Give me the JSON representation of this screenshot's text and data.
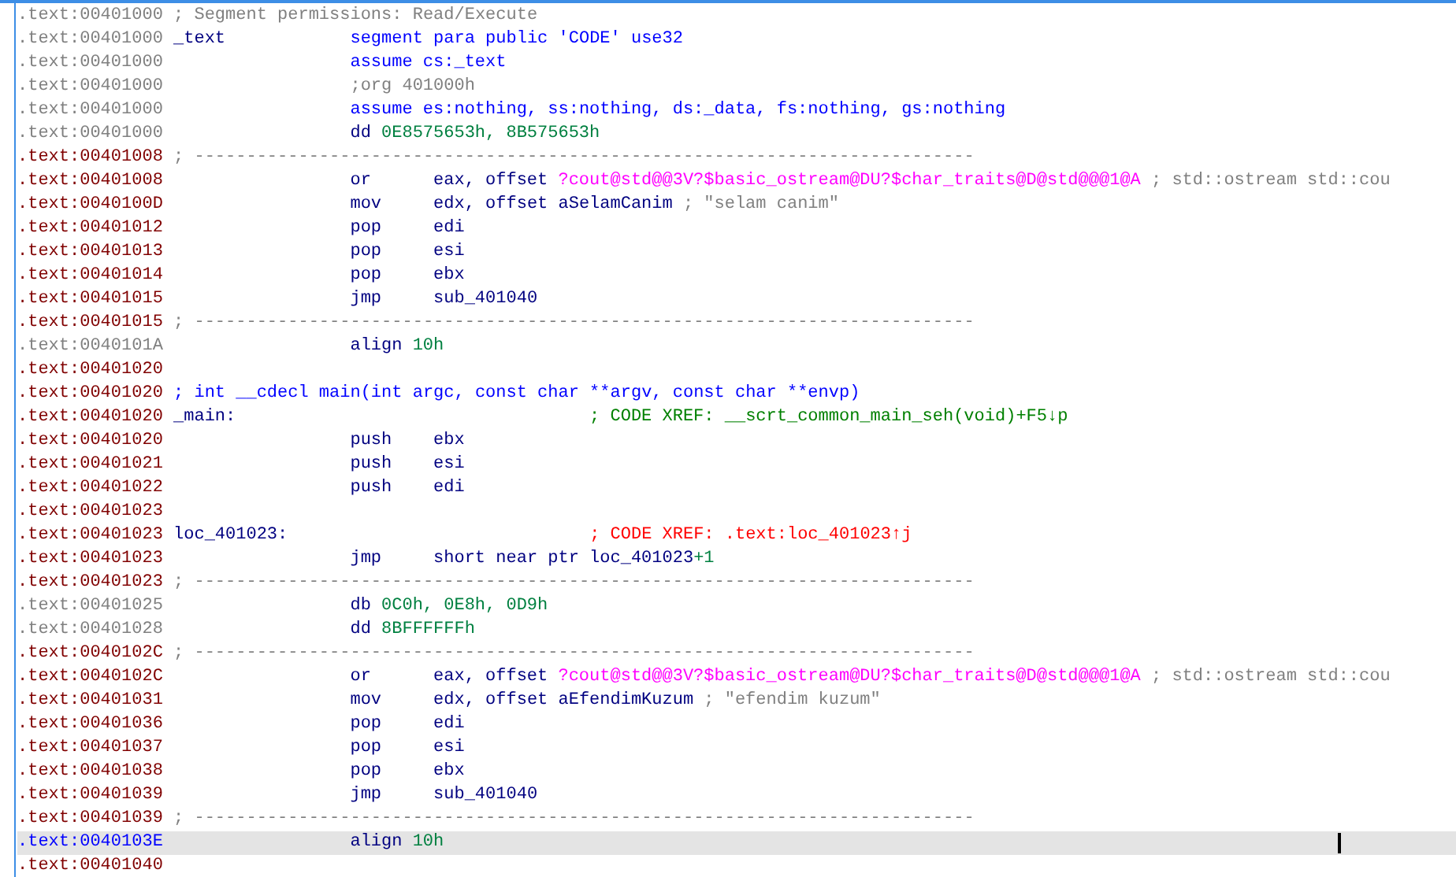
{
  "listing": [
    {
      "address": {
        "text": ".text:00401000",
        "kind": "data"
      },
      "selected": false,
      "comment": {
        "text": "; Segment permissions: Read/Execute",
        "color": "#808080",
        "kind": "header"
      }
    },
    {
      "address": {
        "text": ".text:00401000",
        "kind": "data"
      },
      "selected": false,
      "label": "_text",
      "mnemonic": {
        "text": "segment",
        "kind": "directive"
      },
      "operands": [
        {
          "text": "para public 'CODE' use32",
          "kind": "blue"
        }
      ]
    },
    {
      "address": {
        "text": ".text:00401000",
        "kind": "data"
      },
      "selected": false,
      "mnemonic": {
        "text": "assume",
        "kind": "directive"
      },
      "operands": [
        {
          "text": "cs:_text",
          "kind": "blue"
        }
      ]
    },
    {
      "address": {
        "text": ".text:00401000",
        "kind": "data"
      },
      "selected": false,
      "comment": {
        "text": ";org 401000h",
        "color": "#808080",
        "kind": "code"
      }
    },
    {
      "address": {
        "text": ".text:00401000",
        "kind": "data"
      },
      "selected": false,
      "mnemonic": {
        "text": "assume",
        "kind": "directive"
      },
      "operands": [
        {
          "text": "es:nothing, ss:nothing, ds:_data, fs:nothing, gs:nothing",
          "kind": "blue"
        }
      ]
    },
    {
      "address": {
        "text": ".text:00401000",
        "kind": "data"
      },
      "selected": false,
      "mnemonic": {
        "text": "dd",
        "kind": "data"
      },
      "operands": [
        {
          "text": "0E8575653h, 8B575653h",
          "kind": "number"
        }
      ]
    },
    {
      "address": {
        "text": ".text:00401008",
        "kind": "code"
      },
      "selected": false,
      "comment": {
        "text": "; ---------------------------------------------------------------------------",
        "color": "#808080",
        "kind": "header"
      }
    },
    {
      "address": {
        "text": ".text:00401008",
        "kind": "code"
      },
      "selected": false,
      "mnemonic": {
        "text": "or",
        "kind": "instruction"
      },
      "operands": [
        {
          "text": "eax, offset ",
          "kind": "navy"
        },
        {
          "text": "?cout@std@@3V?$basic_ostream@DU?$char_traits@D@std@@@1@A",
          "kind": "import"
        }
      ],
      "comment": {
        "text": "; std::ostream std::cou",
        "color": "#808080",
        "kind": "inline"
      }
    },
    {
      "address": {
        "text": ".text:0040100D",
        "kind": "code"
      },
      "selected": false,
      "mnemonic": {
        "text": "mov",
        "kind": "instruction"
      },
      "operands": [
        {
          "text": "edx, offset aSelamCanim",
          "kind": "navy"
        }
      ],
      "comment": {
        "text": "; \"selam canim\"",
        "color": "#808080",
        "kind": "inline"
      }
    },
    {
      "address": {
        "text": ".text:00401012",
        "kind": "code"
      },
      "selected": false,
      "mnemonic": {
        "text": "pop",
        "kind": "instruction"
      },
      "operands": [
        {
          "text": "edi",
          "kind": "navy"
        }
      ]
    },
    {
      "address": {
        "text": ".text:00401013",
        "kind": "code"
      },
      "selected": false,
      "mnemonic": {
        "text": "pop",
        "kind": "instruction"
      },
      "operands": [
        {
          "text": "esi",
          "kind": "navy"
        }
      ]
    },
    {
      "address": {
        "text": ".text:00401014",
        "kind": "code"
      },
      "selected": false,
      "mnemonic": {
        "text": "pop",
        "kind": "instruction"
      },
      "operands": [
        {
          "text": "ebx",
          "kind": "navy"
        }
      ]
    },
    {
      "address": {
        "text": ".text:00401015",
        "kind": "code"
      },
      "selected": false,
      "mnemonic": {
        "text": "jmp",
        "kind": "instruction"
      },
      "operands": [
        {
          "text": "sub_401040",
          "kind": "navy"
        }
      ]
    },
    {
      "address": {
        "text": ".text:00401015",
        "kind": "code"
      },
      "selected": false,
      "comment": {
        "text": "; ---------------------------------------------------------------------------",
        "color": "#808080",
        "kind": "header"
      }
    },
    {
      "address": {
        "text": ".text:0040101A",
        "kind": "data"
      },
      "selected": false,
      "mnemonic": {
        "text": "align",
        "kind": "data"
      },
      "operands": [
        {
          "text": "10h",
          "kind": "number"
        }
      ]
    },
    {
      "address": {
        "text": ".text:00401020",
        "kind": "code"
      },
      "selected": false
    },
    {
      "address": {
        "text": ".text:00401020",
        "kind": "code"
      },
      "selected": false,
      "comment": {
        "text": "; int __cdecl main(int argc, const char **argv, const char **envp)",
        "color": "#0000ff",
        "kind": "header"
      }
    },
    {
      "address": {
        "text": ".text:00401020",
        "kind": "code"
      },
      "selected": false,
      "label": "_main:",
      "comment": {
        "text": "; CODE XREF: __scrt_common_main_seh(void)+F5↓p",
        "color": "#008000",
        "kind": "xref"
      }
    },
    {
      "address": {
        "text": ".text:00401020",
        "kind": "code"
      },
      "selected": false,
      "mnemonic": {
        "text": "push",
        "kind": "instruction"
      },
      "operands": [
        {
          "text": "ebx",
          "kind": "navy"
        }
      ]
    },
    {
      "address": {
        "text": ".text:00401021",
        "kind": "code"
      },
      "selected": false,
      "mnemonic": {
        "text": "push",
        "kind": "instruction"
      },
      "operands": [
        {
          "text": "esi",
          "kind": "navy"
        }
      ]
    },
    {
      "address": {
        "text": ".text:00401022",
        "kind": "code"
      },
      "selected": false,
      "mnemonic": {
        "text": "push",
        "kind": "instruction"
      },
      "operands": [
        {
          "text": "edi",
          "kind": "navy"
        }
      ]
    },
    {
      "address": {
        "text": ".text:00401023",
        "kind": "code"
      },
      "selected": false
    },
    {
      "address": {
        "text": ".text:00401023",
        "kind": "code"
      },
      "selected": false,
      "label": "loc_401023:",
      "comment": {
        "text": "; CODE XREF: .text:loc_401023↑j",
        "color": "#ff0000",
        "kind": "xref"
      }
    },
    {
      "address": {
        "text": ".text:00401023",
        "kind": "code"
      },
      "selected": false,
      "mnemonic": {
        "text": "jmp",
        "kind": "instruction"
      },
      "operands": [
        {
          "text": "short near ptr loc_401023",
          "kind": "navy"
        },
        {
          "text": "+1",
          "kind": "number"
        }
      ]
    },
    {
      "address": {
        "text": ".text:00401023",
        "kind": "code"
      },
      "selected": false,
      "comment": {
        "text": "; ---------------------------------------------------------------------------",
        "color": "#808080",
        "kind": "header"
      }
    },
    {
      "address": {
        "text": ".text:00401025",
        "kind": "data"
      },
      "selected": false,
      "mnemonic": {
        "text": "db",
        "kind": "data"
      },
      "operands": [
        {
          "text": "0C0h, 0E8h, 0D9h",
          "kind": "number"
        }
      ]
    },
    {
      "address": {
        "text": ".text:00401028",
        "kind": "data"
      },
      "selected": false,
      "mnemonic": {
        "text": "dd",
        "kind": "data"
      },
      "operands": [
        {
          "text": "8BFFFFFFh",
          "kind": "number"
        }
      ]
    },
    {
      "address": {
        "text": ".text:0040102C",
        "kind": "code"
      },
      "selected": false,
      "comment": {
        "text": "; ---------------------------------------------------------------------------",
        "color": "#808080",
        "kind": "header"
      }
    },
    {
      "address": {
        "text": ".text:0040102C",
        "kind": "code"
      },
      "selected": false,
      "mnemonic": {
        "text": "or",
        "kind": "instruction"
      },
      "operands": [
        {
          "text": "eax, offset ",
          "kind": "navy"
        },
        {
          "text": "?cout@std@@3V?$basic_ostream@DU?$char_traits@D@std@@@1@A",
          "kind": "import"
        }
      ],
      "comment": {
        "text": "; std::ostream std::cou",
        "color": "#808080",
        "kind": "inline"
      }
    },
    {
      "address": {
        "text": ".text:00401031",
        "kind": "code"
      },
      "selected": false,
      "mnemonic": {
        "text": "mov",
        "kind": "instruction"
      },
      "operands": [
        {
          "text": "edx, offset aEfendimKuzum",
          "kind": "navy"
        }
      ],
      "comment": {
        "text": "; \"efendim kuzum\"",
        "color": "#808080",
        "kind": "inline"
      }
    },
    {
      "address": {
        "text": ".text:00401036",
        "kind": "code"
      },
      "selected": false,
      "mnemonic": {
        "text": "pop",
        "kind": "instruction"
      },
      "operands": [
        {
          "text": "edi",
          "kind": "navy"
        }
      ]
    },
    {
      "address": {
        "text": ".text:00401037",
        "kind": "code"
      },
      "selected": false,
      "mnemonic": {
        "text": "pop",
        "kind": "instruction"
      },
      "operands": [
        {
          "text": "esi",
          "kind": "navy"
        }
      ]
    },
    {
      "address": {
        "text": ".text:00401038",
        "kind": "code"
      },
      "selected": false,
      "mnemonic": {
        "text": "pop",
        "kind": "instruction"
      },
      "operands": [
        {
          "text": "ebx",
          "kind": "navy"
        }
      ]
    },
    {
      "address": {
        "text": ".text:00401039",
        "kind": "code"
      },
      "selected": false,
      "mnemonic": {
        "text": "jmp",
        "kind": "instruction"
      },
      "operands": [
        {
          "text": "sub_401040",
          "kind": "navy"
        }
      ]
    },
    {
      "address": {
        "text": ".text:00401039",
        "kind": "code"
      },
      "selected": false,
      "comment": {
        "text": "; ---------------------------------------------------------------------------",
        "color": "#808080",
        "kind": "header"
      }
    },
    {
      "address": {
        "text": ".text:0040103E",
        "kind": "current"
      },
      "selected": true,
      "mnemonic": {
        "text": "align",
        "kind": "data"
      },
      "operands": [
        {
          "text": "10h",
          "kind": "number"
        }
      ]
    },
    {
      "address": {
        "text": ".text:00401040",
        "kind": "code"
      },
      "selected": false
    }
  ]
}
